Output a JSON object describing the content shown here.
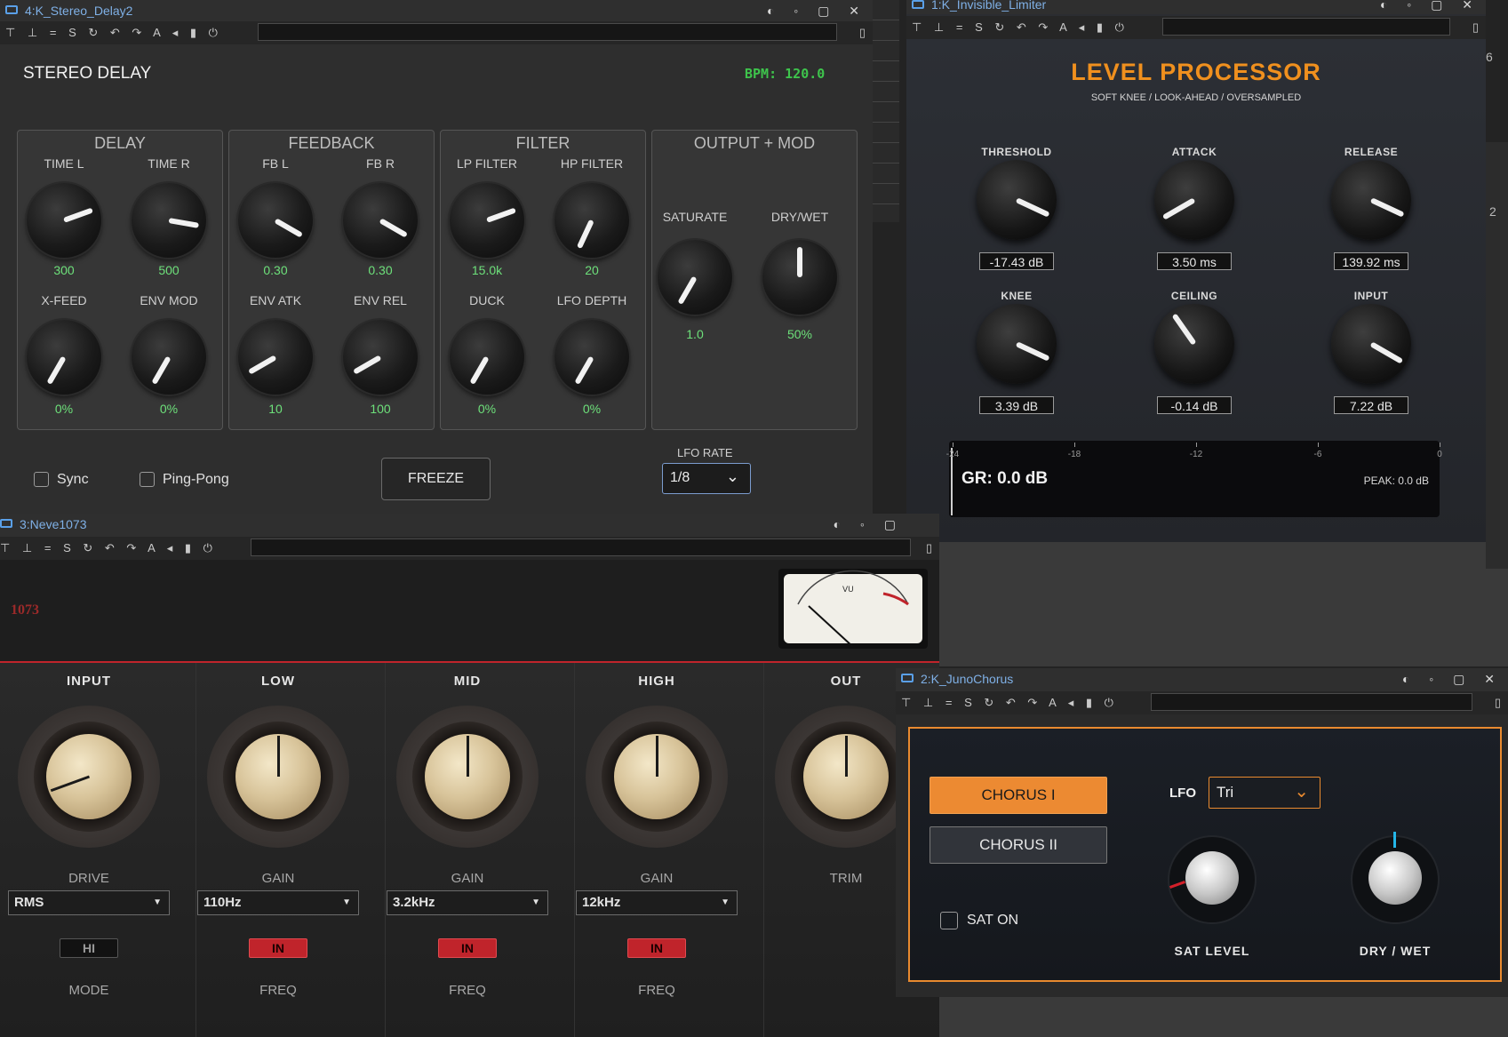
{
  "stereo_delay": {
    "window_title": "4:K_Stereo_Delay2",
    "plugin_name": "STEREO DELAY",
    "bpm": "BPM: 120.0",
    "groups": {
      "delay": "DELAY",
      "feedback": "FEEDBACK",
      "filter": "FILTER",
      "output": "OUTPUT + MOD"
    },
    "knobs": [
      {
        "label": "TIME L",
        "value": "300",
        "angle": 250
      },
      {
        "label": "TIME R",
        "value": "500",
        "angle": 280
      },
      {
        "label": "FB L",
        "value": "0.30",
        "angle": 300
      },
      {
        "label": "FB R",
        "value": "0.30",
        "angle": 300
      },
      {
        "label": "LP FILTER",
        "value": "15.0k",
        "angle": 250
      },
      {
        "label": "HP FILTER",
        "value": "20",
        "angle": 25
      },
      {
        "label": "X-FEED",
        "value": "0%",
        "angle": 30
      },
      {
        "label": "ENV MOD",
        "value": "0%",
        "angle": 30
      },
      {
        "label": "ENV ATK",
        "value": "10",
        "angle": 60
      },
      {
        "label": "ENV REL",
        "value": "100",
        "angle": 60
      },
      {
        "label": "DUCK",
        "value": "0%",
        "angle": 30
      },
      {
        "label": "LFO DEPTH",
        "value": "0%",
        "angle": 30
      },
      {
        "label": "SATURATE",
        "value": "1.0",
        "angle": 30
      },
      {
        "label": "DRY/WET",
        "value": "50%",
        "angle": 180
      }
    ],
    "sync_label": "Sync",
    "pingpong_label": "Ping-Pong",
    "freeze_label": "FREEZE",
    "lfo_rate_label": "LFO RATE",
    "lfo_rate_value": "1/8"
  },
  "limiter": {
    "window_title": "1:K_Invisible_Limiter",
    "title": "LEVEL PROCESSOR",
    "subtitle": "SOFT KNEE / LOOK-AHEAD / OVERSAMPLED",
    "knobs": [
      {
        "label": "THRESHOLD",
        "value": "-17.43 dB",
        "angle": 295
      },
      {
        "label": "ATTACK",
        "value": "3.50 ms",
        "angle": 60
      },
      {
        "label": "RELEASE",
        "value": "139.92 ms",
        "angle": 295
      },
      {
        "label": "KNEE",
        "value": "3.39 dB",
        "angle": 295
      },
      {
        "label": "CEILING",
        "value": "-0.14 dB",
        "angle": 145
      },
      {
        "label": "INPUT",
        "value": "7.22 dB",
        "angle": 300
      }
    ],
    "meter": {
      "ticks": [
        "-24",
        "-18",
        "-12",
        "-6",
        "0"
      ],
      "gr": "GR: 0.0 dB",
      "peak": "PEAK: 0.0 dB"
    },
    "edge_numbers": [
      "6",
      "2"
    ]
  },
  "neve": {
    "window_title": "3:Neve1073",
    "model": "1073",
    "vu_label": "VU",
    "columns": [
      {
        "head": "INPUT",
        "sub": "DRIVE",
        "select": "RMS",
        "button": "HI",
        "button_style": "dark",
        "foot": "MODE",
        "angle": 70
      },
      {
        "head": "LOW",
        "sub": "GAIN",
        "select": "110Hz",
        "button": "IN",
        "button_style": "red",
        "foot": "FREQ",
        "angle": 180
      },
      {
        "head": "MID",
        "sub": "GAIN",
        "select": "3.2kHz",
        "button": "IN",
        "button_style": "red",
        "foot": "FREQ",
        "angle": 180
      },
      {
        "head": "HIGH",
        "sub": "GAIN",
        "select": "12kHz",
        "button": "IN",
        "button_style": "red",
        "foot": "FREQ",
        "angle": 180
      },
      {
        "head": "OUT",
        "sub": "TRIM",
        "select": "",
        "button": "",
        "button_style": "none",
        "foot": "",
        "angle": 180
      }
    ]
  },
  "juno": {
    "window_title": "2:K_JunoChorus",
    "chorus1": "CHORUS I",
    "chorus2": "CHORUS II",
    "lfo_label": "LFO",
    "lfo_value": "Tri",
    "sat_on": "SAT ON",
    "sat_level": "SAT LEVEL",
    "dry_wet": "DRY / WET"
  },
  "colors": {
    "accent_green": "#6de07a",
    "limiter_orange": "#f0901e",
    "neve_red": "#c0242b",
    "juno_orange": "#e98a2f",
    "title_blue": "#7fb0e6"
  }
}
